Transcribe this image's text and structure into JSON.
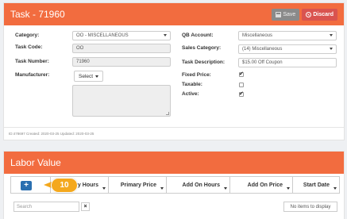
{
  "task": {
    "title": "Task - 71960",
    "save_label": "Save",
    "discard_label": "Discard",
    "labels": {
      "category": "Category:",
      "task_code": "Task Code:",
      "task_number": "Task Number:",
      "manufacturer": "Manufacturer:",
      "qb_account": "QB Account:",
      "sales_category": "Sales Category:",
      "task_description": "Task Description:",
      "fixed_price": "Fixed Price:",
      "taxable": "Taxable:",
      "active": "Active:"
    },
    "values": {
      "category": "OO - MISCELLANEOUS",
      "task_code": "OO",
      "task_number": "71960",
      "manufacturer_select": "Select",
      "qb_account": "Miscellaneous",
      "sales_category": "(14) Miscellaneous",
      "task_description": "$15.00 Off Coupon"
    },
    "checkboxes": {
      "fixed_price": true,
      "taxable": false,
      "active": true
    },
    "footer": "ID:478697  Created: 2020-03-25  Updated: 2020-03-25"
  },
  "labor": {
    "title": "Labor Value",
    "columns": [
      "Primary Hours",
      "Primary Price",
      "Add On Hours",
      "Add On Price",
      "Start Date"
    ],
    "add_label": "+",
    "callout": "10",
    "search_placeholder": "Search",
    "clear_label": "×",
    "no_items": "No items to display"
  },
  "colors": {
    "header": "#f26c3f",
    "discard": "#d9534f",
    "add": "#2a6fb0",
    "callout": "#f4a81d"
  }
}
